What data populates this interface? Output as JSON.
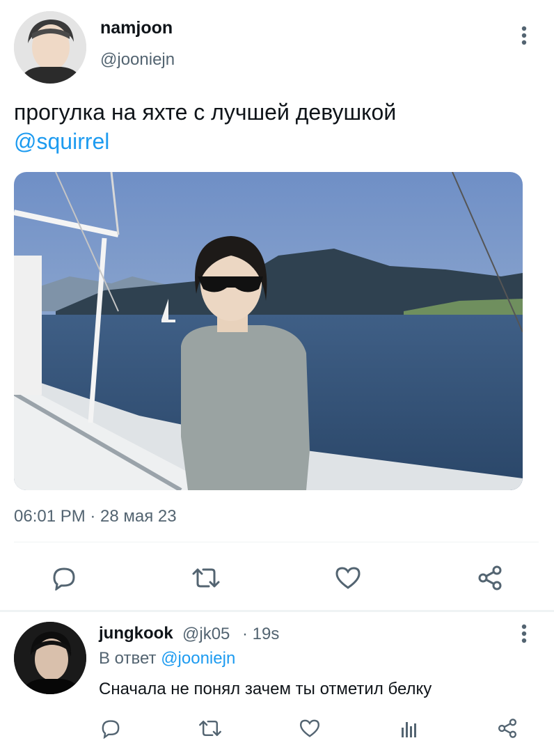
{
  "tweet": {
    "author_name": "namjoon",
    "author_handle": "@jooniejn",
    "text": "прогулка на яхте с лучшей девушкой",
    "mention": "@squirrel",
    "photo_alt": "photo",
    "timestamp": "06:01 PM · 28 мая 23",
    "actions": [
      "reply-icon",
      "retweet-icon",
      "like-icon",
      "share-icon"
    ],
    "more_icon": "more-vertical-icon"
  },
  "reply": {
    "author_name": "jungkook",
    "author_handle": "@jk05",
    "time": "· 19s",
    "reply_prefix": "В ответ",
    "reply_to": "@jooniejn",
    "text": "Сначала не понял зачем ты отметил белку",
    "actions": [
      "reply-icon",
      "retweet-icon",
      "like-icon",
      "analytics-icon",
      "share-icon"
    ]
  },
  "colors": {
    "accent": "#1d9bf0",
    "text": "#0f1419",
    "muted": "#536471",
    "divider": "#eff3f4"
  }
}
